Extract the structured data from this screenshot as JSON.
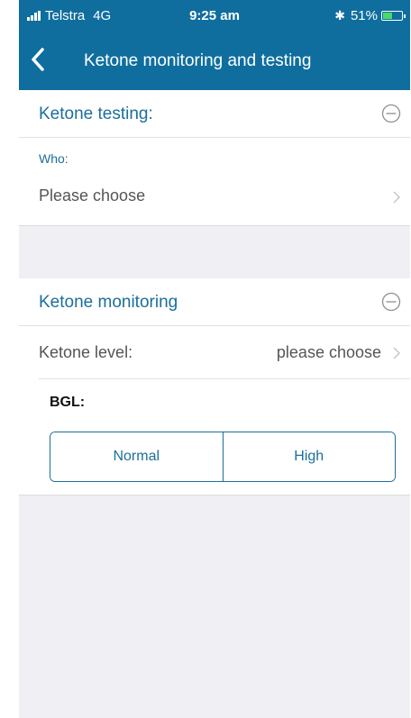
{
  "status_bar": {
    "carrier": "Telstra",
    "network": "4G",
    "time": "9:25 am",
    "battery": "51%",
    "battery_level": 0.51,
    "icons": [
      "signal-icon",
      "bluetooth-icon",
      "battery-icon"
    ]
  },
  "navbar": {
    "title": "Ketone monitoring and testing",
    "back_icon": "back-chevron-icon"
  },
  "ketone_testing": {
    "title": "Ketone testing:",
    "collapse_icon": "minus-circle-icon",
    "who_label": "Who:",
    "who_value": "Please choose"
  },
  "ketone_monitoring": {
    "title": "Ketone monitoring",
    "collapse_icon": "minus-circle-icon",
    "level_label": "Ketone level:",
    "level_value": "please choose",
    "bgl_label": "BGL:",
    "bgl_options": [
      "Normal",
      "High"
    ]
  },
  "colors": {
    "header": "#0f6e9e",
    "accent": "#1b6f9a",
    "background": "#efeff4"
  }
}
